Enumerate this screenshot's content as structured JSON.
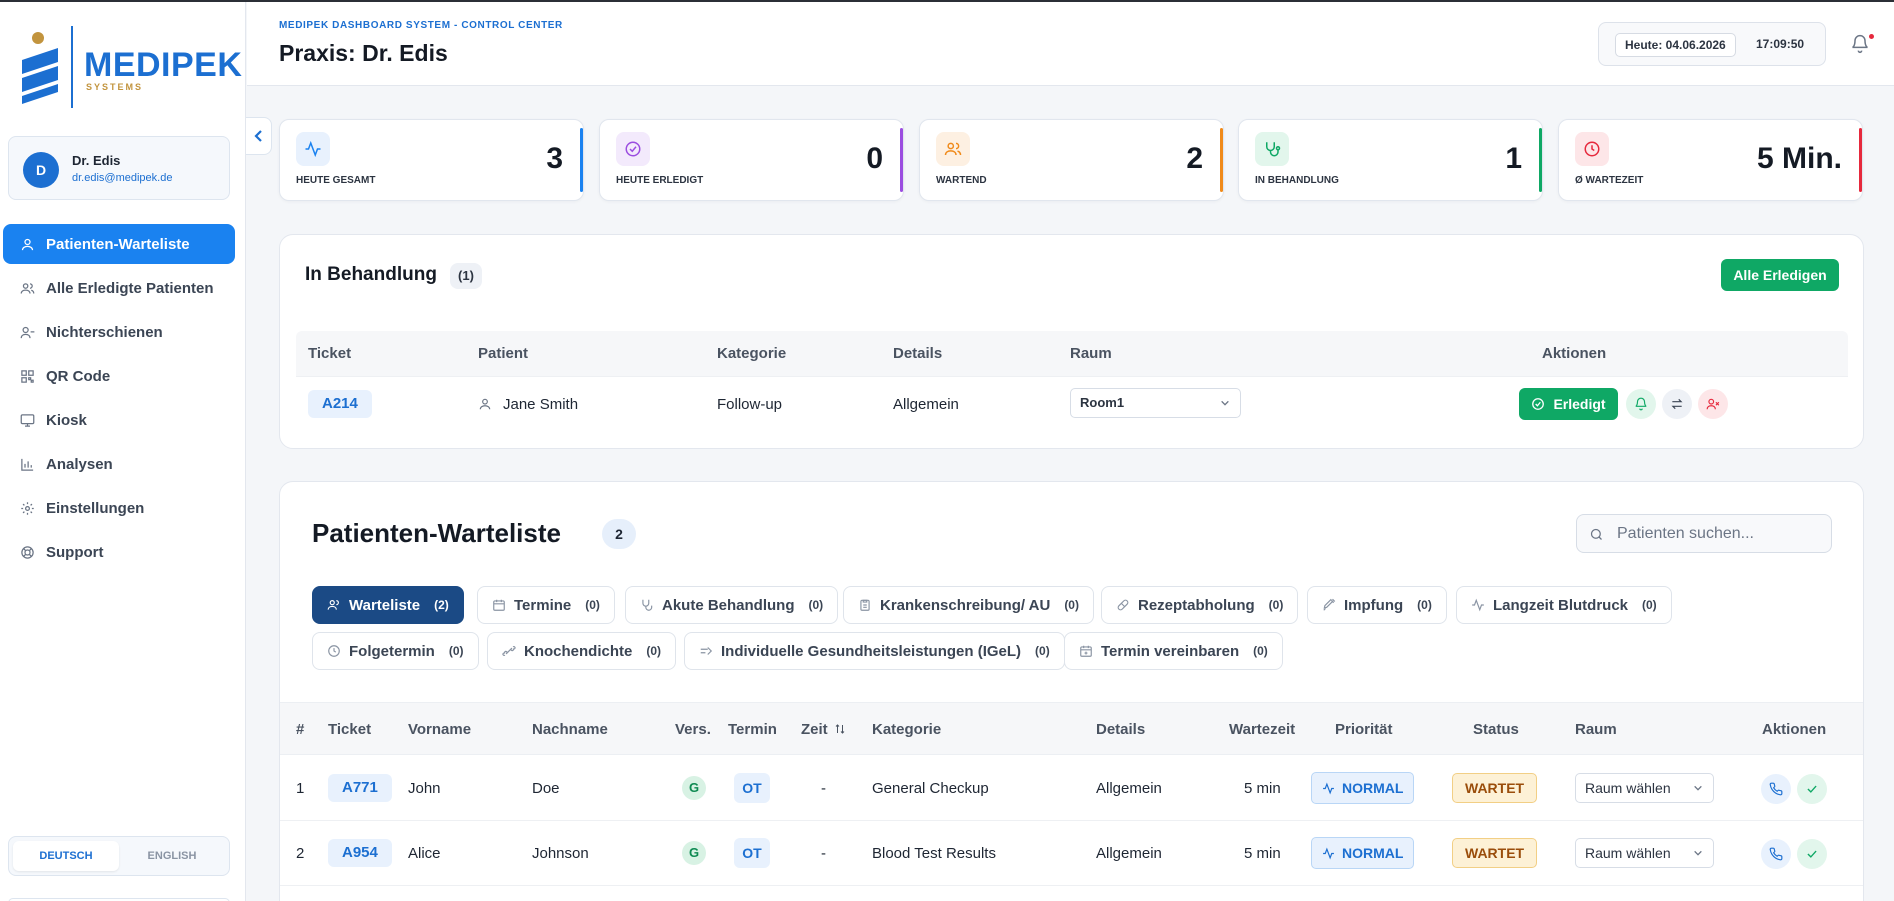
{
  "brand": {
    "name": "MEDIPEK",
    "sub": "SYSTEMS",
    "color": "#1c6fd1"
  },
  "user": {
    "initial": "D",
    "name": "Dr. Edis",
    "email": "dr.edis@medipek.de"
  },
  "nav": [
    {
      "label": "Patienten-Warteliste",
      "icon": "user-icon",
      "active": true
    },
    {
      "label": "Alle Erledigte Patienten",
      "icon": "users-icon"
    },
    {
      "label": "Nichterschienen",
      "icon": "user-minus-icon"
    },
    {
      "label": "QR Code",
      "icon": "qr-code-icon"
    },
    {
      "label": "Kiosk",
      "icon": "monitor-icon"
    },
    {
      "label": "Analysen",
      "icon": "bar-chart-icon"
    },
    {
      "label": "Einstellungen",
      "icon": "gear-icon"
    },
    {
      "label": "Support",
      "icon": "lifebuoy-icon"
    }
  ],
  "lang": {
    "de": "DEUTSCH",
    "en": "ENGLISH"
  },
  "header": {
    "system": "MEDIPEK DASHBOARD SYSTEM - CONTROL CENTER",
    "title": "Praxis: Dr. Edis",
    "date": "Heute: 04.06.2026",
    "time": "17:09:50"
  },
  "stats": [
    {
      "label": "HEUTE GESAMT",
      "value": "3",
      "icon": "activity-icon",
      "color": "#1a82f0",
      "bg": "#e8f1fd"
    },
    {
      "label": "HEUTE ERLEDIGT",
      "value": "0",
      "icon": "check-circle-icon",
      "color": "#9b4de0",
      "bg": "#f3eafc"
    },
    {
      "label": "WARTEND",
      "value": "2",
      "icon": "users-icon",
      "color": "#f08a1a",
      "bg": "#fdf0e2"
    },
    {
      "label": "IN BEHANDLUNG",
      "value": "1",
      "icon": "stethoscope-icon",
      "color": "#0fa865",
      "bg": "#e2f6ec"
    },
    {
      "label": "Ø WARTEZEIT",
      "value": "5 Min.",
      "icon": "clock-icon",
      "color": "#e6293d",
      "bg": "#fde6e8"
    }
  ],
  "treatment": {
    "title": "In Behandlung",
    "count": "(1)",
    "complete_all": "Alle Erledigen",
    "columns": [
      "Ticket",
      "Patient",
      "Kategorie",
      "Details",
      "Raum",
      "Aktionen"
    ],
    "rows": [
      {
        "ticket": "A214",
        "patient": "Jane Smith",
        "category": "Follow-up",
        "details": "Allgemein",
        "room": "Room1",
        "done": "Erledigt"
      }
    ]
  },
  "waitlist": {
    "title": "Patienten-Warteliste",
    "count": "2",
    "search_placeholder": "Patienten suchen...",
    "filters": [
      {
        "label": "Warteliste",
        "count": "(2)",
        "icon": "users-icon",
        "active": true
      },
      {
        "label": "Termine",
        "count": "(0)",
        "icon": "calendar-icon"
      },
      {
        "label": "Akute Behandlung",
        "count": "(0)",
        "icon": "stethoscope-icon"
      },
      {
        "label": "Krankenschreibung/ AU",
        "count": "(0)",
        "icon": "clipboard-icon"
      },
      {
        "label": "Rezeptabholung",
        "count": "(0)",
        "icon": "pill-icon"
      },
      {
        "label": "Impfung",
        "count": "(0)",
        "icon": "syringe-icon"
      },
      {
        "label": "Langzeit Blutdruck",
        "count": "(0)",
        "icon": "activity-icon"
      },
      {
        "label": "Folgetermin",
        "count": "(0)",
        "icon": "clock-icon"
      },
      {
        "label": "Knochendichte",
        "count": "(0)",
        "icon": "bone-icon"
      },
      {
        "label": "Individuelle Gesundheitsleistungen (IGeL)",
        "count": "(0)",
        "icon": "arrow-right-icon"
      },
      {
        "label": "Termin vereinbaren",
        "count": "(0)",
        "icon": "calendar-plus-icon"
      }
    ],
    "columns": {
      "num": "#",
      "ticket": "Ticket",
      "first": "Vorname",
      "last": "Nachname",
      "ins": "Vers.",
      "appt": "Termin",
      "time": "Zeit",
      "cat": "Kategorie",
      "details": "Details",
      "wait": "Wartezeit",
      "prio": "Priorität",
      "status": "Status",
      "room": "Raum",
      "actions": "Aktionen"
    },
    "rows": [
      {
        "num": "1",
        "ticket": "A771",
        "first": "John",
        "last": "Doe",
        "ins": "G",
        "appt": "OT",
        "time": "-",
        "cat": "General Checkup",
        "details": "Allgemein",
        "wait": "5 min",
        "prio": "NORMAL",
        "status": "WARTET",
        "room": "Raum wählen"
      },
      {
        "num": "2",
        "ticket": "A954",
        "first": "Alice",
        "last": "Johnson",
        "ins": "G",
        "appt": "OT",
        "time": "-",
        "cat": "Blood Test Results",
        "details": "Allgemein",
        "wait": "5 min",
        "prio": "NORMAL",
        "status": "WARTET",
        "room": "Raum wählen"
      }
    ]
  }
}
